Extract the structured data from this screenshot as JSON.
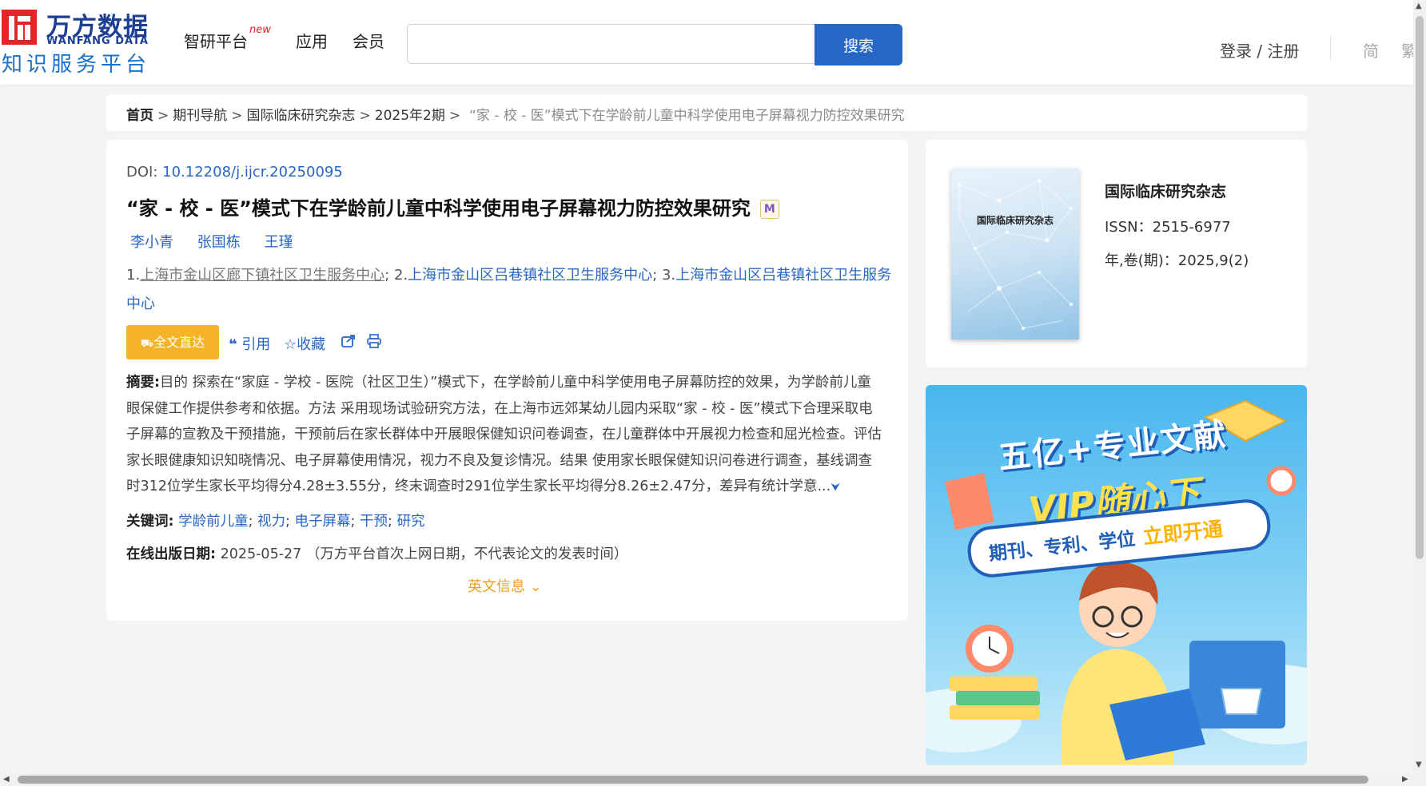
{
  "header": {
    "logo": {
      "cn": "万方数据",
      "en": "WANFANG DATA",
      "sub": "知识服务平台"
    },
    "nav": [
      {
        "label": "智研平台",
        "badge": "new"
      },
      {
        "label": "应用"
      },
      {
        "label": "会员"
      }
    ],
    "search": {
      "value": "",
      "placeholder": "",
      "button": "搜索"
    },
    "login": "登录 / 注册",
    "lang_simplified": "简",
    "lang_traditional": "繁"
  },
  "breadcrumb": {
    "items": [
      "首页",
      "期刊导航",
      "国际临床研究杂志",
      "2025年2期"
    ],
    "separator": ">",
    "current": "“家 - 校 - 医”模式下在学龄前儿童中科学使用电子屏幕视力防控效果研究"
  },
  "article": {
    "doi_label": "DOI:",
    "doi": "10.12208/j.ijcr.20250095",
    "title": "“家 - 校 - 医”模式下在学龄前儿童中科学使用电子屏幕视力防控效果研究",
    "title_icon": "M",
    "authors": [
      "李小青",
      "张国栋",
      "王瑾"
    ],
    "affiliations": [
      {
        "index": "1.",
        "name": "上海市金山区廊下镇社区卫生服务中心"
      },
      {
        "index": "2.",
        "name": "上海市金山区吕巷镇社区卫生服务中心"
      },
      {
        "index": "3.",
        "name": "上海市金山区吕巷镇社区卫生服务中心"
      }
    ],
    "actions": {
      "fulltext": "全文直达",
      "cite": "引用",
      "favorite": "收藏"
    },
    "abstract_label": "摘要:",
    "abstract": "目的 探索在“家庭 - 学校 - 医院（社区卫生）”模式下，在学龄前儿童中科学使用电子屏幕防控的效果，为学龄前儿童眼保健工作提供参考和依据。方法 采用现场试验研究方法，在上海市远郊某幼儿园内采取“家 - 校 - 医”模式下合理采取电子屏幕的宣教及干预措施，干预前后在家长群体中开展眼保健知识问卷调查，在儿童群体中开展视力检查和屈光检查。评估家长眼健康知识知晓情况、电子屏幕使用情况，视力不良及复诊情况。结果 使用家长眼保健知识问卷进行调查，基线调查时312位学生家长平均得分4.28±3.55分，终末调查时291位学生家长平均得分8.26±2.47分，差异有统计学意...",
    "keywords_label": "关键词:",
    "keywords": [
      "学龄前儿童",
      "视力",
      "电子屏幕",
      "干预",
      "研究"
    ],
    "pubdate_label": "在线出版日期:",
    "pubdate": "2025-05-27",
    "pubdate_note": "（万方平台首次上网日期，不代表论文的发表时间）",
    "english_info": "英文信息"
  },
  "journal": {
    "name": "国际临床研究杂志",
    "cover_title": "国际临床研究杂志",
    "issn": "ISSN：2515-6977",
    "volume": "年,卷(期)：2025,9(2)"
  },
  "ad": {
    "line1": "五亿+专业文献",
    "line2": "VIP随心下",
    "line3": "期刊、专利、学位",
    "line3_highlight": "立即开通"
  },
  "colors": {
    "brand_red": "#e02727",
    "brand_blue": "#1c3f94",
    "link_blue": "#2766c4",
    "accent_orange": "#f4b32b"
  }
}
